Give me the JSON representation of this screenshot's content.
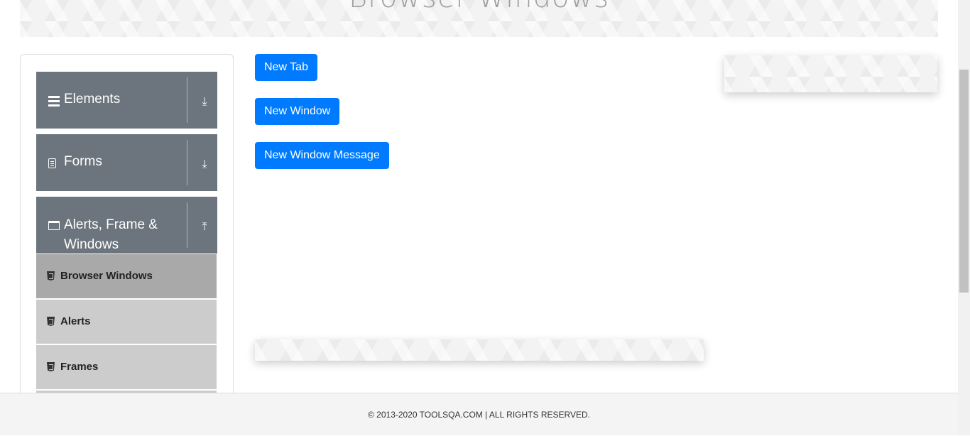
{
  "page": {
    "title": "Browser Windows"
  },
  "sidebar": {
    "groups": [
      {
        "label": "Elements",
        "icon": "menu-icon",
        "expanded": false
      },
      {
        "label": "Forms",
        "icon": "document-icon",
        "expanded": false
      },
      {
        "label": "Alerts, Frame & Windows",
        "icon": "window-icon",
        "expanded": true
      }
    ],
    "items": [
      {
        "label": "Browser Windows",
        "active": true
      },
      {
        "label": "Alerts"
      },
      {
        "label": "Frames"
      }
    ]
  },
  "buttons": {
    "new_tab": "New Tab",
    "new_window": "New Window",
    "new_window_message": "New Window Message"
  },
  "footer": {
    "text": "© 2013-2020 TOOLSQA.COM | ALL RIGHTS RESERVED."
  },
  "colors": {
    "primary": "#007bff",
    "group_bg": "#6c757d",
    "item_bg": "#cccccc",
    "item_active_bg": "#a9a9a9"
  }
}
